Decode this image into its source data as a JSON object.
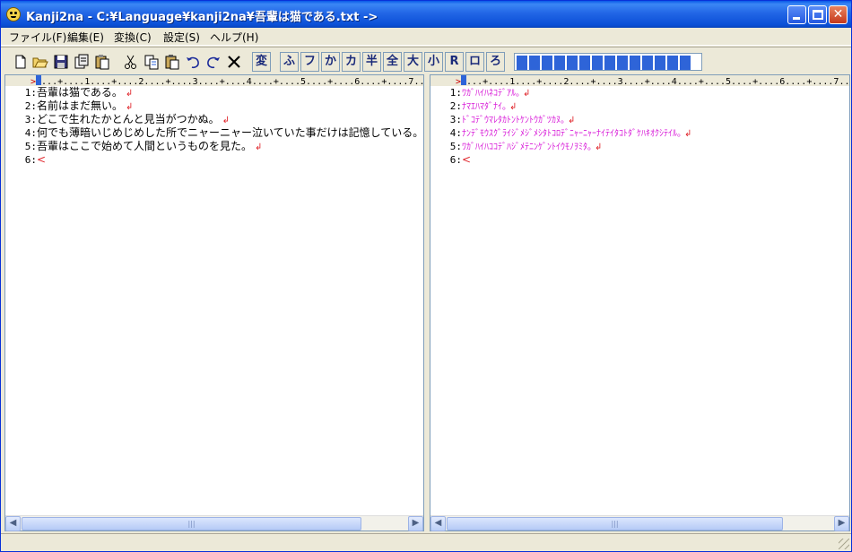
{
  "window": {
    "title": "Kanji2na - C:¥Language¥kanji2na¥吾輩は猫である.txt ->"
  },
  "menu": [
    {
      "id": "menu-file",
      "label": "ファイル(F)"
    },
    {
      "id": "menu-edit",
      "label": "編集(E)"
    },
    {
      "id": "menu-convert",
      "label": "変換(C)"
    },
    {
      "id": "menu-settings",
      "label": "設定(S)"
    },
    {
      "id": "menu-help",
      "label": "ヘルプ(H)"
    }
  ],
  "toolbar": {
    "icons": [
      "new-file-icon",
      "open-folder-icon",
      "save-icon",
      "copy-file-icon",
      "paste-file-icon",
      "cut-icon",
      "copy-icon",
      "paste-icon",
      "undo-icon",
      "redo-icon",
      "delete-icon"
    ],
    "convert_label": "変",
    "kana_buttons": [
      "ふ",
      "フ",
      "か",
      "カ",
      "半",
      "全",
      "大",
      "小",
      "R",
      "ロ",
      "ろ"
    ],
    "progress": 1.0,
    "colors": {
      "progress": "#2e64d8",
      "kana_output": "#d81ad8",
      "eol_mark": "#e0242a"
    }
  },
  "ruler": {
    "caret": ">",
    "scale": "...+....1....+....2....+....3....+....4....+....5....+....6....+....7..."
  },
  "left_pane": {
    "lines": [
      {
        "n": "1:",
        "text": "吾輩は猫である。",
        "eol": "↲"
      },
      {
        "n": "2:",
        "text": "名前はまだ無い。",
        "eol": "↲"
      },
      {
        "n": "3:",
        "text": "どこで生れたかとんと見当がつかぬ。",
        "eol": "↲"
      },
      {
        "n": "4:",
        "text": "何でも薄暗いじめじめした所でニャーニャー泣いていた事だけは記憶している。",
        "eol": ""
      },
      {
        "n": "5:",
        "text": "吾輩はここで始めて人間というものを見た。",
        "eol": "↲"
      },
      {
        "n": "6:",
        "text": "",
        "eol": "",
        "eof": "<"
      }
    ]
  },
  "right_pane": {
    "lines": [
      {
        "n": "1:",
        "text": "ﾜｶﾞﾊｲﾊﾈｺﾃﾞｱﾙ｡",
        "eol": "↲"
      },
      {
        "n": "2:",
        "text": "ﾅﾏｴﾊﾏﾀﾞﾅｲ｡",
        "eol": "↲"
      },
      {
        "n": "3:",
        "text": "ﾄﾞｺﾃﾞｳﾏﾚﾀｶﾄﾝﾄｹﾝﾄｳｶﾞﾂｶﾇ｡",
        "eol": "↲"
      },
      {
        "n": "4:",
        "text": "ﾅﾝﾃﾞﾓｳｽｸﾞﾗｲｼﾞﾒｼﾞﾒｼﾀﾄｺﾛﾃﾞﾆｬｰﾆｬｰﾅｲﾃｲﾀｺﾄﾀﾞｹﾊｷｵｸｼﾃｲﾙ｡",
        "eol": "↲"
      },
      {
        "n": "5:",
        "text": "ﾜｶﾞﾊｲﾊｺｺﾃﾞﾊｼﾞﾒﾃﾆﾝｹﾞﾝﾄｲｳﾓﾉｦﾐﾀ｡",
        "eol": "↲"
      },
      {
        "n": "6:",
        "text": "",
        "eol": "",
        "eof": "<"
      }
    ]
  },
  "scrollbar": {
    "thumb_grip": "|||"
  }
}
